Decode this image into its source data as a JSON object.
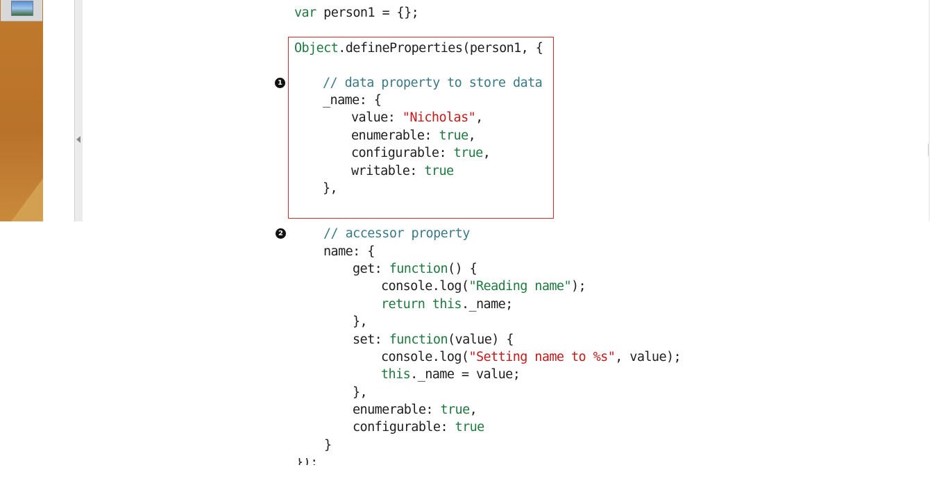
{
  "markers": [
    "1",
    "2"
  ],
  "code": {
    "l01": {
      "a": "var",
      "b": " person1 = {};"
    },
    "l02": {
      "a": "Object",
      "b": ".defineProperties(person1, {"
    },
    "l03": {
      "a": "// data property to store data"
    },
    "l04": {
      "a": "_name: {"
    },
    "l05": {
      "a": "value: ",
      "b": "\"Nicholas\"",
      "c": ","
    },
    "l06": {
      "a": "enumerable: ",
      "b": "true",
      "c": ","
    },
    "l07": {
      "a": "configurable: ",
      "b": "true",
      "c": ","
    },
    "l08": {
      "a": "writable: ",
      "b": "true"
    },
    "l09": {
      "a": "},"
    },
    "l10": {
      "a": "// accessor property"
    },
    "l11": {
      "a": "name: {"
    },
    "l12": {
      "a": "get: ",
      "b": "function",
      "c": "() {"
    },
    "l13": {
      "a": "console.log(",
      "b": "\"Reading name\"",
      "c": ");"
    },
    "l14": {
      "a": "return",
      "b": " ",
      "c": "this",
      "d": "._name;"
    },
    "l15": {
      "a": "},"
    },
    "l16": {
      "a": "set: ",
      "b": "function",
      "c": "(value) {"
    },
    "l17": {
      "a": "console.log(",
      "b": "\"Setting name to %s\"",
      "c": ", value);"
    },
    "l18": {
      "a": "this",
      "b": "._name = value;"
    },
    "l19": {
      "a": "},"
    },
    "l20": {
      "a": "enumerable: ",
      "b": "true",
      "c": ","
    },
    "l21": {
      "a": "configurable: ",
      "b": "true"
    },
    "l22": {
      "a": "}"
    },
    "l23": {
      "a": "});"
    }
  }
}
